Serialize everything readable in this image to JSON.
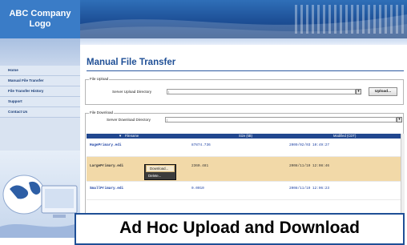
{
  "logo": {
    "line1": "ABC Company",
    "line2": "Logo"
  },
  "sidebar": {
    "items": [
      {
        "label": "Home"
      },
      {
        "label": "Manual File Transfer"
      },
      {
        "label": "File Transfer History"
      },
      {
        "label": "Support"
      },
      {
        "label": "Contact Us"
      }
    ]
  },
  "page": {
    "title": "Manual File Transfer"
  },
  "upload": {
    "legend": "File Upload",
    "dir_label": "Server Upload Directory",
    "dir_value": "\\",
    "button_label": "Upload..."
  },
  "download": {
    "legend": "File Download",
    "dir_label": "Server Download Directory",
    "dir_value": "\\"
  },
  "table": {
    "headers": {
      "filename": "Filename",
      "size": "Size (kB)",
      "modified": "Modified (CDT)"
    },
    "sort_indicator": "▼",
    "rows": [
      {
        "filename": "HugePrimary.edi",
        "size": "87874.736",
        "modified": "2009/02/03 10:49:27",
        "selected": false
      },
      {
        "filename": "LargePrimary.edi",
        "size": "2360.481",
        "modified": "2008/11/19 12:08:46",
        "selected": true
      },
      {
        "filename": "SmallPrimary.edi",
        "size": "0.0010",
        "modified": "2008/11/19 12:06:23",
        "selected": false
      }
    ]
  },
  "context_menu": {
    "items": [
      "Download...",
      "Delete..."
    ]
  },
  "caption": {
    "text": "Ad Hoc Upload and Download"
  },
  "colors": {
    "brand": "#1f4f96",
    "header_blue": "#21478f",
    "selected_row": "#f2d9a8"
  }
}
